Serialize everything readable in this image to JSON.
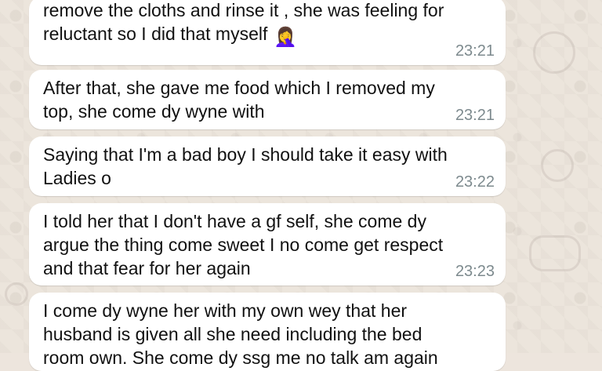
{
  "colors": {
    "background": "#ece5dc",
    "bubble": "#ffffff",
    "text": "#111111",
    "time": "#7d8a8e"
  },
  "messages": [
    {
      "text": "remove the cloths and rinse it , she was feeling for\nreluctant so I did that myself",
      "emoji": "🤦‍♀️",
      "time": "23:21"
    },
    {
      "text": "After that, she gave me food which I removed my\ntop, she come dy wyne with",
      "time": "23:21"
    },
    {
      "text": "Saying that I'm a bad boy I should take it easy with\nLadies o",
      "time": "23:22"
    },
    {
      "text": "I told her that I don't have a gf self, she come dy\nargue the thing come sweet I no come get respect\nand that fear for her again",
      "time": "23:23"
    },
    {
      "text": "I come dy wyne her with my own wey that her\nhusband is given all she need including the bed\nroom own. She come dy ssg me no talk am again",
      "time": ""
    }
  ]
}
